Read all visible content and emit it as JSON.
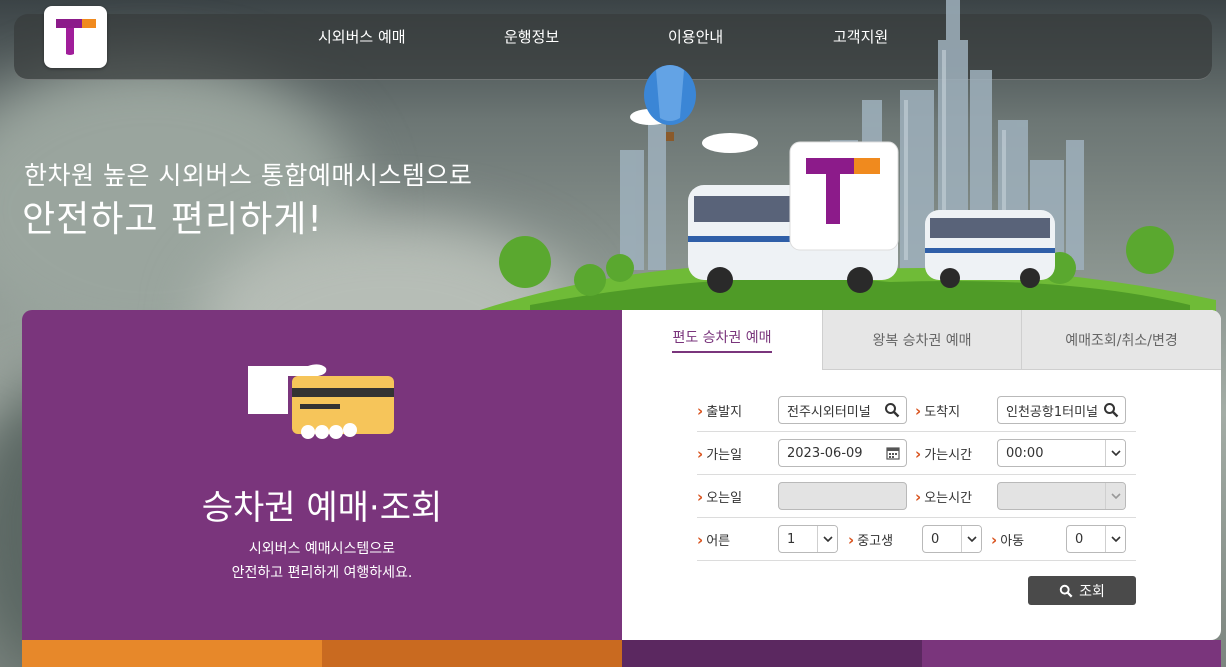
{
  "nav": {
    "items": [
      {
        "label": "시외버스 예매"
      },
      {
        "label": "운행정보"
      },
      {
        "label": "이용안내"
      },
      {
        "label": "고객지원"
      }
    ]
  },
  "hero": {
    "line1": "한차원 높은 시외버스 통합예매시스템으로",
    "line2": "안전하고 편리하게!"
  },
  "promo": {
    "title": "승차권 예매·조회",
    "desc_line1": "시외버스 예매시스템으로",
    "desc_line2": "안전하고 편리하게 여행하세요."
  },
  "tabs": [
    {
      "label": "편도 승차권 예매",
      "active": true
    },
    {
      "label": "왕복 승차권 예매",
      "active": false
    },
    {
      "label": "예매조회/취소/변경",
      "active": false
    }
  ],
  "form": {
    "departure": {
      "label": "출발지",
      "value": "전주시외터미널"
    },
    "arrival": {
      "label": "도착지",
      "value": "인천공항1터미널"
    },
    "depart_date": {
      "label": "가는일",
      "value": "2023-06-09"
    },
    "depart_time": {
      "label": "가는시간",
      "value": "00:00"
    },
    "return_date": {
      "label": "오는일",
      "value": ""
    },
    "return_time": {
      "label": "오는시간",
      "value": ""
    },
    "adult": {
      "label": "어른",
      "value": "1"
    },
    "youth": {
      "label": "중고생",
      "value": "0"
    },
    "child": {
      "label": "아동",
      "value": "0"
    },
    "search_label": "조회"
  },
  "colors": {
    "brand_purple": "#7a357c",
    "brand_orange": "#f08a1e",
    "accent_label": "#d9531e",
    "button_dark": "#4a4a4a"
  },
  "icons": {
    "logo": "t-logo-icon",
    "search": "search-icon",
    "calendar": "calendar-icon",
    "dropdown": "chevron-down-icon",
    "ticket": "hand-card-icon"
  }
}
